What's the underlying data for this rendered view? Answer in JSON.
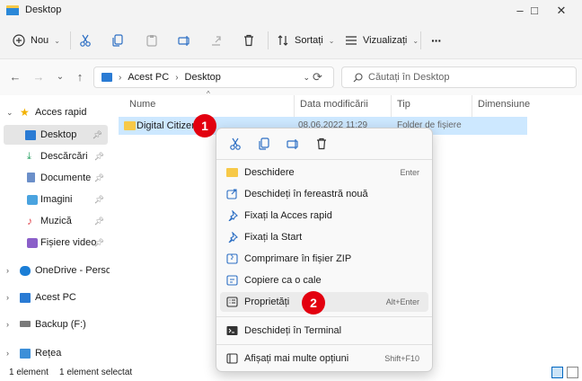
{
  "window": {
    "title": "Desktop",
    "minimize": "–",
    "maximize": "□",
    "close": "✕"
  },
  "toolbar": {
    "new_label": "Nou",
    "sort_label": "Sortați",
    "view_label": "Vizualizați",
    "more_label": "···"
  },
  "address": {
    "back": "←",
    "forward": "→",
    "history": "⌄",
    "up": "↑",
    "crumbs": [
      "Acest PC",
      "Desktop"
    ],
    "refresh": "⟳",
    "search_placeholder": "Căutați în Desktop"
  },
  "sidebar": {
    "items": [
      {
        "label": "Acces rapid",
        "icon": "star-icon"
      },
      {
        "label": "Desktop",
        "icon": "desktop-icon"
      },
      {
        "label": "Descărcări",
        "icon": "download-icon"
      },
      {
        "label": "Documente",
        "icon": "document-icon"
      },
      {
        "label": "Imagini",
        "icon": "image-icon"
      },
      {
        "label": "Muzică",
        "icon": "music-icon"
      },
      {
        "label": "Fișiere video",
        "icon": "video-icon"
      },
      {
        "label": "OneDrive - Personal",
        "icon": "cloud-icon"
      },
      {
        "label": "Acest PC",
        "icon": "pc-icon"
      },
      {
        "label": "Backup (F:)",
        "icon": "drive-icon"
      },
      {
        "label": "Rețea",
        "icon": "network-icon"
      }
    ]
  },
  "columns": [
    "Nume",
    "Data modificării",
    "Tip",
    "Dimensiune"
  ],
  "files": [
    {
      "name": "Digital Citizen",
      "date": "08.06.2022 11:29",
      "type": "Folder de fișiere"
    }
  ],
  "badges": [
    "1",
    "2"
  ],
  "status": {
    "count": "1 element",
    "selected": "1 element selectat"
  },
  "context_menu": {
    "quick_actions": [
      "cut-icon",
      "copy-icon",
      "rename-icon",
      "delete-icon"
    ],
    "items": [
      {
        "label": "Deschidere",
        "shortcut": "Enter",
        "icon": "folder-icon"
      },
      {
        "label": "Deschideți în fereastră nouă",
        "shortcut": "",
        "icon": "open-new-window-icon"
      },
      {
        "label": "Fixați la Acces rapid",
        "shortcut": "",
        "icon": "pin-icon"
      },
      {
        "label": "Fixați la Start",
        "shortcut": "",
        "icon": "pin-icon"
      },
      {
        "label": "Comprimare în fișier ZIP",
        "shortcut": "",
        "icon": "zip-icon"
      },
      {
        "label": "Copiere ca o cale",
        "shortcut": "",
        "icon": "copy-path-icon"
      },
      {
        "label": "Proprietăți",
        "shortcut": "Alt+Enter",
        "icon": "properties-icon"
      },
      {
        "label": "Deschideți în Terminal",
        "shortcut": "",
        "icon": "terminal-icon"
      },
      {
        "label": "Afișați mai multe opțiuni",
        "shortcut": "Shift+F10",
        "icon": "more-options-icon"
      }
    ]
  },
  "colors": {
    "accent": "#0067c0",
    "badge": "#e3000f",
    "selection": "#cde8ff",
    "folder": "#f7c948"
  }
}
